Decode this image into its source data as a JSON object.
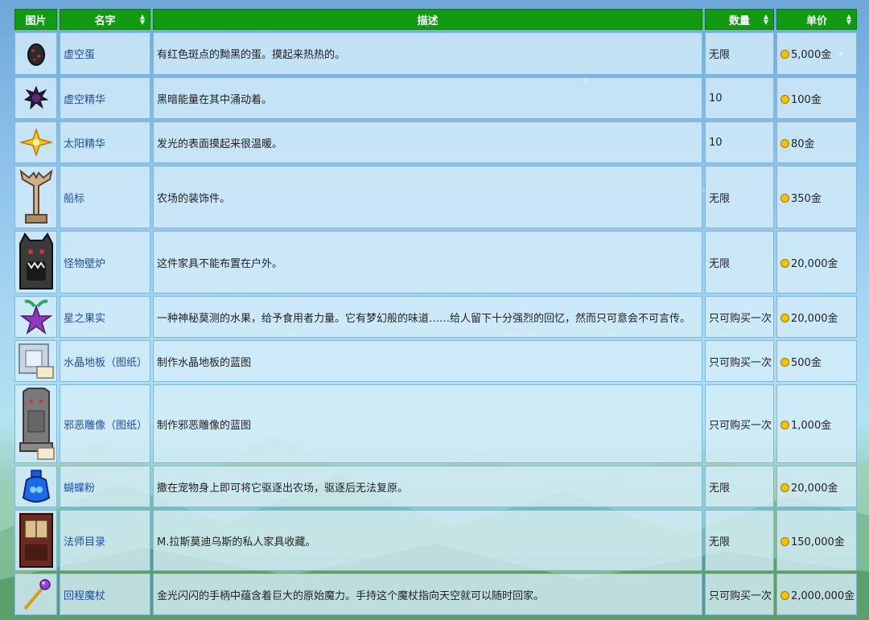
{
  "headers": {
    "image": "图片",
    "name": "名字",
    "description": "描述",
    "quantity": "数量",
    "price": "单价"
  },
  "icons": {
    "sort": "sort-icon",
    "coin": "gold-coin-icon"
  },
  "colors": {
    "header_bg": "#129a12",
    "name_link": "#1f4fa8",
    "coin": "#f5c400"
  },
  "items": [
    {
      "icon": "void-egg-icon",
      "name": "虚空蛋",
      "desc": "有红色斑点的黝黑的蛋。摸起来热热的。",
      "qty": "无限",
      "price": "5,000金"
    },
    {
      "icon": "void-essence-icon",
      "name": "虚空精华",
      "desc": "黑暗能量在其中涌动着。",
      "qty": "10",
      "price": "100金"
    },
    {
      "icon": "solar-essence-icon",
      "name": "太阳精华",
      "desc": "发光的表面摸起来很温暖。",
      "qty": "10",
      "price": "80金"
    },
    {
      "icon": "signpost-icon",
      "name": "船标",
      "desc": "农场的装饰件。",
      "qty": "无限",
      "price": "350金"
    },
    {
      "icon": "monster-fireplace-icon",
      "name": "怪物壁炉",
      "desc": "这件家具不能布置在户外。",
      "qty": "无限",
      "price": "20,000金"
    },
    {
      "icon": "stardrop-icon",
      "name": "星之果实",
      "desc": "一种神秘莫测的水果，给予食用者力量。它有梦幻般的味道……给人留下十分强烈的回忆，然而只可意会不可言传。",
      "qty": "只可购买一次",
      "price": "20,000金"
    },
    {
      "icon": "crystal-floor-blueprint-icon",
      "name": "水晶地板（图纸）",
      "desc": "制作水晶地板的蓝图",
      "qty": "只可购买一次",
      "price": "500金"
    },
    {
      "icon": "wicked-statue-blueprint-icon",
      "name": "邪恶雕像（图纸）",
      "desc": "制作邪恶雕像的蓝图",
      "qty": "只可购买一次",
      "price": "1,000金"
    },
    {
      "icon": "monster-musk-icon",
      "name": "蝴蝶粉",
      "desc": "撒在宠物身上即可将它驱逐出农场，驱逐后无法复原。",
      "qty": "无限",
      "price": "20,000金"
    },
    {
      "icon": "wizard-catalogue-icon",
      "name": "法师目录",
      "desc": "M.拉斯莫迪乌斯的私人家具收藏。",
      "qty": "无限",
      "price": "150,000金"
    },
    {
      "icon": "return-scepter-icon",
      "name": "回程魔杖",
      "desc": "金光闪闪的手柄中蕴含着巨大的原始魔力。手持这个魔杖指向天空就可以随时回家。",
      "qty": "只可购买一次",
      "price": "2,000,000金"
    }
  ]
}
